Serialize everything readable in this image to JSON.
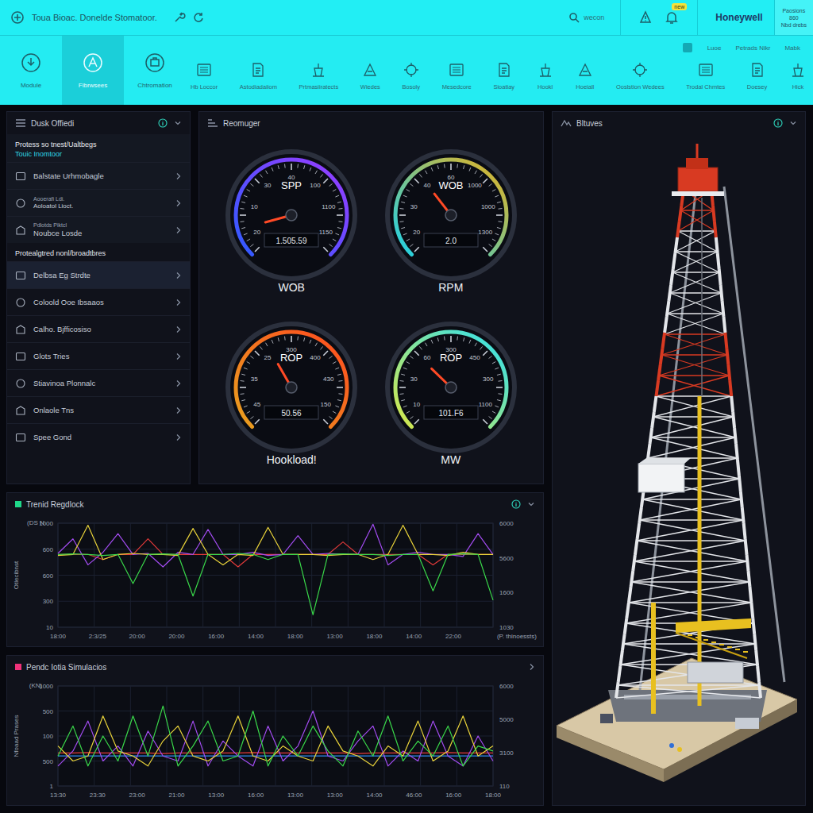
{
  "topbar": {
    "title": "Toua Bioac. Donelde Stomatoor.",
    "search": "wecon",
    "badge": "new",
    "brand": "Honeywell",
    "info": [
      "Paosions",
      "860",
      "Nbd drebs"
    ]
  },
  "nav": {
    "primary": [
      {
        "label": "Module",
        "selected": false
      },
      {
        "label": "Fibrwsees",
        "selected": true
      },
      {
        "label": "Chtromation",
        "selected": false
      }
    ],
    "corner": [
      "Luoe",
      "Petrads Nikr",
      "Mabk"
    ],
    "secondary": [
      {
        "label": "Hb Loccor",
        "selected": false
      },
      {
        "label": "Astodiadaiiom",
        "selected": false
      },
      {
        "label": "Prtmasiiratects",
        "selected": false
      },
      {
        "label": "Wiedes",
        "selected": false
      },
      {
        "label": "Bosoly",
        "selected": false
      },
      {
        "label": "Mesedcore",
        "selected": false
      },
      {
        "label": "Sioatiay",
        "selected": false
      },
      {
        "label": "Hookl",
        "selected": false
      },
      {
        "label": "Hoeiall",
        "selected": false
      },
      {
        "label": "Ooslstion Wedees",
        "selected": false
      },
      {
        "label": "Trodal Chmtes",
        "selected": false
      },
      {
        "label": "Doesey",
        "selected": false
      },
      {
        "label": "Hick",
        "selected": false
      }
    ]
  },
  "sidebar": {
    "title": "Dusk Offiedi",
    "groups": [
      {
        "title": "Protess so tnest/Ualtbegs",
        "subtitle": "Touic Inomtoor",
        "items": [
          {
            "label": "Balstate Urhmobagle",
            "selected": false
          },
          {
            "caption": "Aooerafi Ldi.",
            "label": "Aoloatol Lioct.",
            "selected": false
          },
          {
            "caption": "Pdlotds Piktcl",
            "label": "Noubce Losde",
            "selected": false
          }
        ]
      },
      {
        "title": "Protealgtred nonl/broadtbres",
        "items": [
          {
            "label": "Delbsa Eg Strdte",
            "selected": true
          },
          {
            "label": "Coloold Ooe Ibsaaos",
            "selected": false
          },
          {
            "label": "Calho. Bjfficosiso",
            "selected": false
          },
          {
            "label": "Glots Tries",
            "selected": false
          },
          {
            "label": "Stiavinoa Plonnalc",
            "selected": false
          },
          {
            "label": "Onlaole Tns",
            "selected": false
          },
          {
            "label": "Spee Gond",
            "selected": false
          }
        ]
      }
    ]
  },
  "gauges_panel": {
    "title": "Reomuger",
    "gauges": [
      {
        "name": "SPP",
        "value": "1.505.59",
        "caption": "WOB",
        "level": 0.11,
        "colors": [
          "#2f5bff",
          "#9b3cff"
        ],
        "ticks": [
          "20",
          "10",
          "30",
          "40",
          "100",
          "1100",
          "1150"
        ]
      },
      {
        "name": "WOB",
        "value": "2.0",
        "caption": "RPM",
        "level": 0.36,
        "colors": [
          "#1fd2e8",
          "#e8b21f"
        ],
        "ticks": [
          "20",
          "30",
          "40",
          "60",
          "1000",
          "1000",
          "1300"
        ]
      },
      {
        "name": "ROP",
        "value": "50.56",
        "caption": "Hookload!",
        "level": 0.39,
        "colors": [
          "#e8a01f",
          "#ff4a1f"
        ],
        "ticks": [
          "45",
          "35",
          "25",
          "300",
          "400",
          "430",
          "150"
        ]
      },
      {
        "name": "ROP",
        "value": "101.F6",
        "caption": "MW",
        "level": 0.33,
        "colors": [
          "#d8e84a",
          "#2fe0f0"
        ],
        "ticks": [
          "10",
          "30",
          "60",
          "300",
          "450",
          "300",
          "1100"
        ]
      }
    ]
  },
  "charts": [
    {
      "title": "Trenid Regdlock",
      "color": "#1fd88a",
      "unit": "(DS N",
      "y_title": "Otlecibnst",
      "y_ticks": [
        "1000",
        "600",
        "600",
        "300",
        "10"
      ],
      "y2_ticks": [
        "6000",
        "5600",
        "1600",
        "1030"
      ],
      "x_ticks": [
        "18:00",
        "2:3/25",
        "20:00",
        "20:00",
        "16:00",
        "14:00",
        "18:00",
        "13:00",
        "18:00",
        "14:00",
        "22:00"
      ],
      "x_title": "(P. thinoessts)",
      "series": [
        {
          "color": "#e23a3a",
          "values": [
            700,
            700,
            700,
            650,
            700,
            700,
            850,
            700,
            700,
            700,
            700,
            700,
            580,
            700,
            700,
            700,
            700,
            700,
            700,
            820,
            700,
            700,
            700,
            700,
            700,
            600,
            700,
            700,
            700,
            700
          ]
        },
        {
          "color": "#a24cf0",
          "values": [
            710,
            850,
            600,
            720,
            900,
            700,
            710,
            580,
            720,
            700,
            940,
            700,
            700,
            720,
            690,
            700,
            880,
            700,
            710,
            700,
            700,
            990,
            600,
            700,
            720,
            700,
            700,
            680,
            900,
            700
          ]
        },
        {
          "color": "#e8d23a",
          "values": [
            690,
            700,
            980,
            650,
            700,
            710,
            700,
            700,
            690,
            950,
            700,
            600,
            700,
            690,
            960,
            700,
            700,
            700,
            690,
            700,
            700,
            650,
            700,
            980,
            700,
            700,
            690,
            720,
            700,
            700
          ]
        },
        {
          "color": "#3ad84a",
          "values": [
            700,
            705,
            700,
            690,
            700,
            420,
            700,
            705,
            700,
            300,
            700,
            700,
            710,
            700,
            650,
            700,
            700,
            120,
            700,
            705,
            700,
            700,
            690,
            700,
            700,
            350,
            700,
            705,
            700,
            260
          ]
        }
      ]
    },
    {
      "title": "Pendc Iotia Simulacios",
      "color": "#f0327a",
      "unit": "(KN)",
      "y_title": "Nfoaad Prases",
      "y_ticks": [
        "1000",
        "500",
        "100",
        "500",
        "1"
      ],
      "y2_ticks": [
        "6000",
        "5000",
        "3100",
        "110"
      ],
      "x_ticks": [
        "13:30",
        "23:30",
        "23:00",
        "21:00",
        "13:00",
        "16:00",
        "13:00",
        "13:00",
        "14:00",
        "46:00",
        "16:00",
        "18:00"
      ],
      "series": [
        {
          "color": "#2f8cf0",
          "values": [
            300,
            300,
            300,
            300,
            300,
            300,
            300,
            300,
            300,
            300,
            300,
            300,
            300,
            300,
            300,
            300,
            300,
            300,
            300,
            300,
            300,
            300,
            300,
            300,
            300,
            300,
            300,
            300,
            300,
            300
          ]
        },
        {
          "color": "#e23a3a",
          "values": [
            330,
            330,
            335,
            330,
            330,
            330,
            330,
            325,
            330,
            330,
            330,
            330,
            330,
            335,
            330,
            330,
            330,
            330,
            330,
            330,
            325,
            330,
            330,
            330,
            330,
            330,
            335,
            330,
            330,
            330
          ]
        },
        {
          "color": "#a24cf0",
          "values": [
            200,
            350,
            650,
            250,
            400,
            200,
            550,
            300,
            250,
            650,
            200,
            450,
            300,
            200,
            600,
            250,
            400,
            750,
            300,
            250,
            450,
            600,
            200,
            350,
            250,
            650,
            300,
            200,
            500,
            250
          ]
        },
        {
          "color": "#e8d23a",
          "values": [
            400,
            250,
            300,
            700,
            350,
            300,
            200,
            450,
            600,
            300,
            250,
            350,
            700,
            300,
            250,
            400,
            300,
            250,
            600,
            350,
            300,
            200,
            400,
            300,
            650,
            250,
            350,
            700,
            300,
            400
          ]
        },
        {
          "color": "#3ad84a",
          "values": [
            300,
            600,
            200,
            500,
            250,
            700,
            300,
            800,
            200,
            400,
            650,
            250,
            300,
            750,
            200,
            500,
            300,
            600,
            350,
            200,
            550,
            300,
            700,
            250,
            450,
            300,
            600,
            200,
            400,
            350
          ]
        }
      ]
    }
  ],
  "rig_panel": {
    "title": "Bltuves"
  }
}
